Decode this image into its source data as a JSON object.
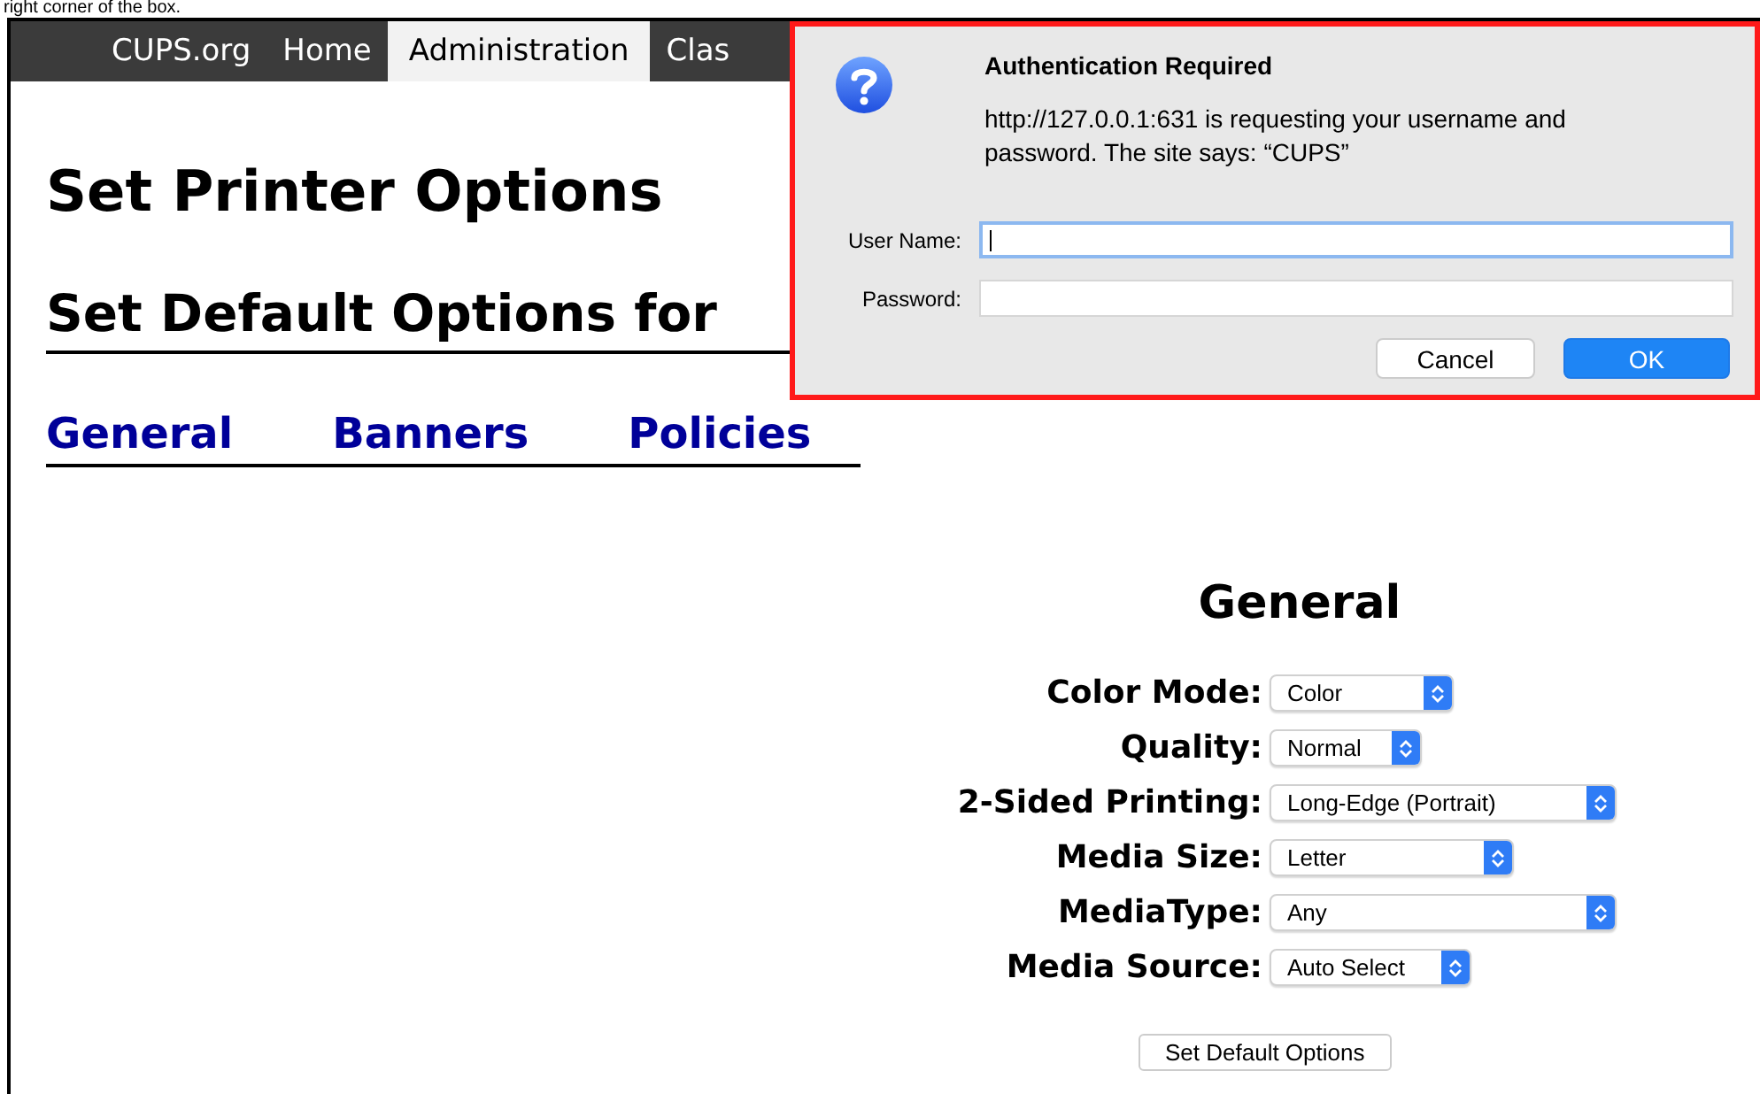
{
  "caption": "right corner of the box.",
  "nav": {
    "items": [
      {
        "label": "CUPS.org",
        "selected": false
      },
      {
        "label": "Home",
        "selected": false
      },
      {
        "label": "Administration",
        "selected": true
      },
      {
        "label": "Clas",
        "selected": false
      }
    ]
  },
  "page": {
    "title": "Set Printer Options",
    "subtitle": "Set Default Options for",
    "tabs": [
      {
        "label": "General"
      },
      {
        "label": "Banners"
      },
      {
        "label": "Policies"
      }
    ],
    "section_title": "General",
    "options": [
      {
        "label": "Color Mode:",
        "value": "Color"
      },
      {
        "label": "Quality:",
        "value": "Normal"
      },
      {
        "label": "2-Sided Printing:",
        "value": "Long-Edge (Portrait)"
      },
      {
        "label": "Media Size:",
        "value": "Letter"
      },
      {
        "label": "MediaType:",
        "value": "Any"
      },
      {
        "label": "Media Source:",
        "value": "Auto Select"
      }
    ],
    "submit": "Set Default Options"
  },
  "dialog": {
    "title": "Authentication Required",
    "message": "http://127.0.0.1:631 is requesting your username and password. The site says: “CUPS”",
    "fields": [
      {
        "label": "User Name:",
        "focused": true
      },
      {
        "label": "Password:",
        "focused": false
      }
    ],
    "buttons": [
      {
        "label": "Cancel",
        "kind": "secondary"
      },
      {
        "label": "OK",
        "kind": "primary"
      }
    ]
  }
}
